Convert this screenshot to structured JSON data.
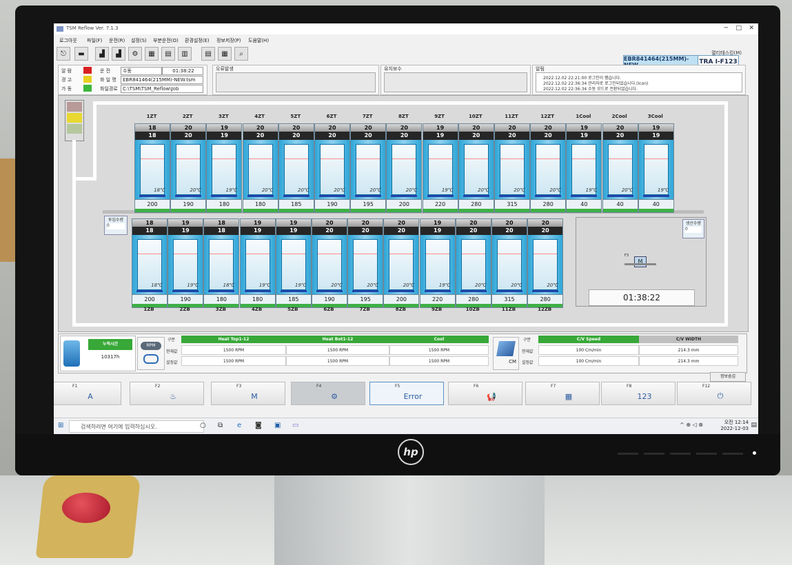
{
  "window": {
    "title": "TSM Reflow Ver. 7.1.3",
    "min": "─",
    "max": "□",
    "close": "✕"
  },
  "menu": [
    "로그아웃",
    "파일(F)",
    "운전(R)",
    "설정(S)",
    "부분운전(O)",
    "환경설정(E)",
    "정보저장(P)",
    "도움말(H)"
  ],
  "right_menu": "멀티태스킹(M)",
  "model": "EBR841464(215MM)-NEW",
  "line": "TRA I-F123",
  "status": {
    "labels": [
      "알 람",
      "경 고",
      "가 동"
    ],
    "run_label": "운 전",
    "run_value": "수동",
    "run_time": "01:38:22",
    "file_label": "화 일 명",
    "file_value": "EBR841464(215MM)-NEW.tsm",
    "path_label": "화일경로",
    "path_value": "C:\\TSM\\TSM_Reflow\\Job"
  },
  "panels": {
    "error": "오류발생",
    "maintenance": "유지보수",
    "alarm": "알림",
    "alarm_lines": [
      "2022.12.02 22:21:00 로그인이 됐습니다.",
      "2022.12.02 22:36:34 관리자로 로그인되었습니다.(Icon)",
      "2022.12.02 22:36:34 수동 모드로 전환되었습니다."
    ]
  },
  "top_zones": [
    {
      "name": "1ZT",
      "sv": "18",
      "pv": "",
      "temp": "18℃",
      "set": "200"
    },
    {
      "name": "2ZT",
      "sv": "20",
      "pv": "",
      "temp": "20℃",
      "set": "190"
    },
    {
      "name": "3ZT",
      "sv": "19",
      "pv": "",
      "temp": "19℃",
      "set": "180"
    },
    {
      "name": "4ZT",
      "sv": "20",
      "pv": "",
      "temp": "20℃",
      "set": "180"
    },
    {
      "name": "5ZT",
      "sv": "20",
      "pv": "",
      "temp": "20℃",
      "set": "185"
    },
    {
      "name": "6ZT",
      "sv": "20",
      "pv": "",
      "temp": "20℃",
      "set": "190"
    },
    {
      "name": "7ZT",
      "sv": "20",
      "pv": "",
      "temp": "20℃",
      "set": "195"
    },
    {
      "name": "8ZT",
      "sv": "20",
      "pv": "",
      "temp": "20℃",
      "set": "200"
    },
    {
      "name": "9ZT",
      "sv": "19",
      "pv": "",
      "temp": "19℃",
      "set": "220"
    },
    {
      "name": "10ZT",
      "sv": "20",
      "pv": "",
      "temp": "20℃",
      "set": "280"
    },
    {
      "name": "11ZT",
      "sv": "20",
      "pv": "",
      "temp": "20℃",
      "set": "315"
    },
    {
      "name": "12ZT",
      "sv": "20",
      "pv": "",
      "temp": "20℃",
      "set": "280"
    },
    {
      "name": "1Cool",
      "sv": "19",
      "pv": "",
      "temp": "19℃",
      "set": "40"
    },
    {
      "name": "2Cool",
      "sv": "20",
      "pv": "",
      "temp": "20℃",
      "set": "40"
    },
    {
      "name": "3Cool",
      "sv": "19",
      "pv": "",
      "temp": "19℃",
      "set": "40"
    }
  ],
  "bottom_zones": [
    {
      "name": "1ZB",
      "sv": "18",
      "temp": "18℃",
      "set": "200"
    },
    {
      "name": "2ZB",
      "sv": "19",
      "temp": "19℃",
      "set": "190"
    },
    {
      "name": "3ZB",
      "sv": "18",
      "temp": "18℃",
      "set": "180"
    },
    {
      "name": "4ZB",
      "sv": "19",
      "temp": "19℃",
      "set": "180"
    },
    {
      "name": "5ZB",
      "sv": "19",
      "temp": "19℃",
      "set": "185"
    },
    {
      "name": "6ZB",
      "sv": "20",
      "temp": "20℃",
      "set": "190"
    },
    {
      "name": "7ZB",
      "sv": "20",
      "temp": "20℃",
      "set": "195"
    },
    {
      "name": "8ZB",
      "sv": "20",
      "temp": "20℃",
      "set": "200"
    },
    {
      "name": "9ZB",
      "sv": "19",
      "temp": "19℃",
      "set": "220"
    },
    {
      "name": "10ZB",
      "sv": "20",
      "temp": "20℃",
      "set": "280"
    },
    {
      "name": "11ZB",
      "sv": "20",
      "temp": "20℃",
      "set": "315"
    },
    {
      "name": "12ZB",
      "sv": "20",
      "temp": "20℃",
      "set": "280"
    }
  ],
  "input_count_label": "투입수량",
  "input_count": "0",
  "output_count_label": "생산수량",
  "output_count": "0",
  "clock": "01:38:22",
  "f3_mini_key": "F3",
  "f3_mini_icon": "M",
  "info": {
    "cum_time_label": "누적시간",
    "cum_time": "10317h",
    "rpm_label": "RPM",
    "col_label": "구분",
    "row_current": "현재값",
    "row_set": "설정값",
    "heads": [
      "Heat Top1-12",
      "Heat Bot1-12",
      "Cool"
    ],
    "current": [
      "1500 RPM",
      "1500 RPM",
      "1500 RPM"
    ],
    "setv": [
      "1500 RPM",
      "1500 RPM",
      "1500 RPM"
    ],
    "cv_heads": [
      "C/V Speed",
      "C/V WIDTH"
    ],
    "cv_current": [
      "100 Cm/min",
      "214.3 mm"
    ],
    "cv_set": [
      "100 Cm/min",
      "214.3 mm"
    ],
    "cm_label": "CM",
    "detail_button": "정보숨김"
  },
  "fkeys": [
    {
      "key": "F1",
      "icon": "A",
      "state": ""
    },
    {
      "key": "F2",
      "icon": "♨",
      "state": ""
    },
    {
      "key": "F3",
      "icon": "M",
      "state": ""
    },
    {
      "key": "F4",
      "icon": "⚙",
      "state": ""
    },
    {
      "key": "F5",
      "icon": "Error",
      "state": ""
    },
    {
      "key": "F6",
      "icon": "📢",
      "state": "ON"
    },
    {
      "key": "F7",
      "icon": "▦",
      "state": ""
    },
    {
      "key": "F8",
      "icon": "123",
      "state": ""
    },
    {
      "key": "F12",
      "icon": "⏻",
      "state": ""
    }
  ],
  "taskbar": {
    "search_placeholder": "검색하려면 여기에 입력하십시오.",
    "time": "오전 12:14",
    "date": "2022-12-03"
  },
  "colors": {
    "green": "#38a838",
    "zone_blue": "#2fa6d8",
    "alarm_red": "#d92020",
    "warn_yellow": "#e8d020",
    "run_green": "#3cb83c"
  }
}
